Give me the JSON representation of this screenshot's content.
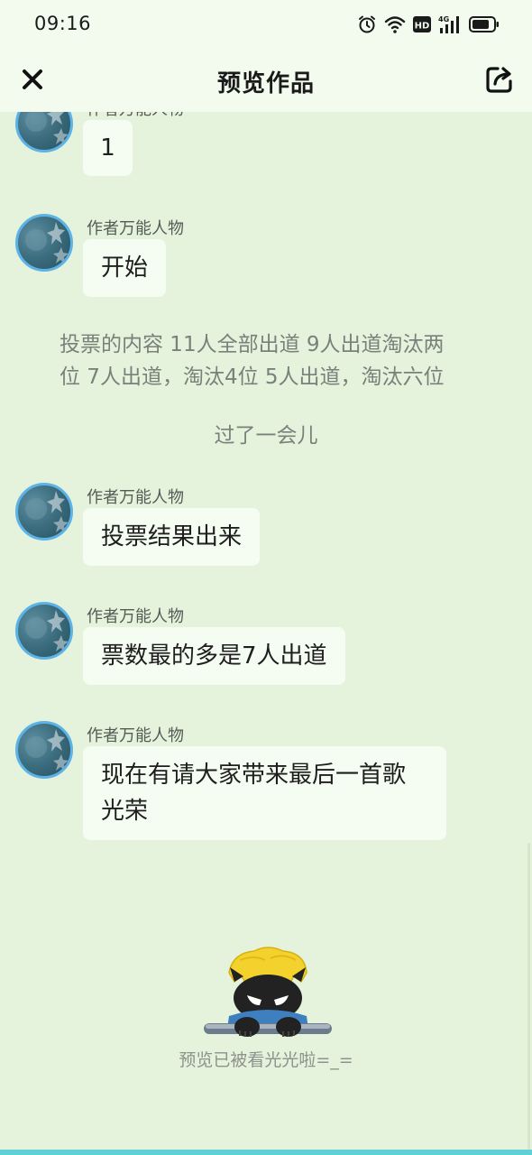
{
  "status_bar": {
    "time": "09:16",
    "icons": [
      "alarm-icon",
      "wifi-icon",
      "hd-icon",
      "signal-4g-icon",
      "battery-icon"
    ],
    "hd_label": "HD",
    "network_label": "4G"
  },
  "header": {
    "title": "预览作品",
    "close_icon": "close-icon",
    "share_icon": "share-icon"
  },
  "messages": [
    {
      "type": "bubble",
      "author": "作者万能人物",
      "text": "1"
    },
    {
      "type": "bubble",
      "author": "作者万能人物",
      "text": "开始"
    },
    {
      "type": "narration",
      "line1": "投票的内容  11人全部出道 9人出道淘汰两",
      "line2": "位  7人出道，淘汰4位  5人出道，淘汰六位"
    },
    {
      "type": "narration",
      "text": "过了一会儿"
    },
    {
      "type": "bubble",
      "author": "作者万能人物",
      "text": "投票结果出来"
    },
    {
      "type": "bubble",
      "author": "作者万能人物",
      "text": "票数最的多是7人出道"
    },
    {
      "type": "bubble",
      "author": "作者万能人物",
      "line1": "现在有请大家带来最后一首歌",
      "line2": "光荣"
    }
  ],
  "footer": {
    "end_text": "预览已被看光光啦=_=",
    "mascot_icon": "mascot-character-icon"
  },
  "colors": {
    "background": "#e5f3dd",
    "header_bg": "#f2fbee",
    "bubble_bg": "#f5fcf1",
    "avatar_border": "#5db3e6",
    "bottom_accent": "#5fd0d6"
  }
}
